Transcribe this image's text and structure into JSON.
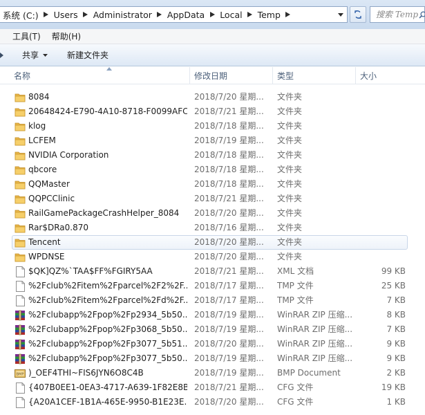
{
  "address": {
    "crumbs": [
      "系统 (C:)",
      "Users",
      "Administrator",
      "AppData",
      "Local",
      "Temp"
    ]
  },
  "search": {
    "placeholder": "搜索 Temp"
  },
  "menu": [
    "工具(T)",
    "帮助(H)"
  ],
  "toolbar": {
    "share_label": "共享",
    "newfolder_label": "新建文件夹"
  },
  "columns": {
    "name": "名称",
    "date": "修改日期",
    "type": "类型",
    "size": "大小"
  },
  "files": [
    {
      "icon": "folder-icon",
      "name": "8084",
      "date": "2018/7/20 星期...",
      "type": "文件夹",
      "size": ""
    },
    {
      "icon": "folder-icon",
      "name": "20648424-E790-4A10-8718-F0099AFC...",
      "date": "2018/7/21 星期...",
      "type": "文件夹",
      "size": ""
    },
    {
      "icon": "folder-icon",
      "name": "klog",
      "date": "2018/7/18 星期...",
      "type": "文件夹",
      "size": ""
    },
    {
      "icon": "folder-icon",
      "name": "LCFEM",
      "date": "2018/7/19 星期...",
      "type": "文件夹",
      "size": ""
    },
    {
      "icon": "folder-icon",
      "name": "NVIDIA Corporation",
      "date": "2018/7/18 星期...",
      "type": "文件夹",
      "size": ""
    },
    {
      "icon": "folder-icon",
      "name": "qbcore",
      "date": "2018/7/18 星期...",
      "type": "文件夹",
      "size": ""
    },
    {
      "icon": "folder-icon",
      "name": "QQMaster",
      "date": "2018/7/18 星期...",
      "type": "文件夹",
      "size": ""
    },
    {
      "icon": "folder-icon",
      "name": "QQPCClinic",
      "date": "2018/7/21 星期...",
      "type": "文件夹",
      "size": ""
    },
    {
      "icon": "folder-icon",
      "name": "RailGamePackageCrashHelper_8084",
      "date": "2018/7/20 星期...",
      "type": "文件夹",
      "size": ""
    },
    {
      "icon": "folder-icon",
      "name": "Rar$DRa0.870",
      "date": "2018/7/16 星期...",
      "type": "文件夹",
      "size": ""
    },
    {
      "icon": "folder-icon",
      "name": "Tencent",
      "date": "2018/7/20 星期...",
      "type": "文件夹",
      "size": "",
      "selected": true
    },
    {
      "icon": "folder-icon",
      "name": "WPDNSE",
      "date": "2018/7/20 星期...",
      "type": "文件夹",
      "size": ""
    },
    {
      "icon": "file-icon",
      "name": "$QK]QZ%`TAA$FF%FGIRY5AA",
      "date": "2018/7/21 星期...",
      "type": "XML 文档",
      "size": "99 KB"
    },
    {
      "icon": "file-icon",
      "name": "%2Fclub%2Fitem%2Fparcel%2F2%2F...",
      "date": "2018/7/17 星期...",
      "type": "TMP 文件",
      "size": "25 KB"
    },
    {
      "icon": "file-icon",
      "name": "%2Fclub%2Fitem%2Fparcel%2Fd%2F...",
      "date": "2018/7/17 星期...",
      "type": "TMP 文件",
      "size": "7 KB"
    },
    {
      "icon": "winrar-icon",
      "name": "%2Fclubapp%2Fpop%2Fp2934_5b50...",
      "date": "2018/7/19 星期...",
      "type": "WinRAR ZIP 压缩...",
      "size": "8 KB"
    },
    {
      "icon": "winrar-icon",
      "name": "%2Fclubapp%2Fpop%2Fp3068_5b50...",
      "date": "2018/7/19 星期...",
      "type": "WinRAR ZIP 压缩...",
      "size": "7 KB"
    },
    {
      "icon": "winrar-icon",
      "name": "%2Fclubapp%2Fpop%2Fp3077_5b51...",
      "date": "2018/7/20 星期...",
      "type": "WinRAR ZIP 压缩...",
      "size": "9 KB"
    },
    {
      "icon": "winrar-icon",
      "name": "%2Fclubapp%2Fpop%2Fp3077_5b50...",
      "date": "2018/7/19 星期...",
      "type": "WinRAR ZIP 压缩...",
      "size": "9 KB"
    },
    {
      "icon": "bmp-icon",
      "name": ")_OEF4THI~FIS6JYN6O8C4B",
      "date": "2018/7/19 星期...",
      "type": "BMP Document",
      "size": "2 KB"
    },
    {
      "icon": "file-icon",
      "name": "{407B0EE1-0EA3-4717-A639-1F82E8B...",
      "date": "2018/7/21 星期...",
      "type": "CFG 文件",
      "size": "19 KB"
    },
    {
      "icon": "file-icon",
      "name": "{A20A1CEF-1B1A-465E-9950-B1E23E...",
      "date": "2018/7/20 星期...",
      "type": "CFG 文件",
      "size": "1 KB"
    }
  ]
}
